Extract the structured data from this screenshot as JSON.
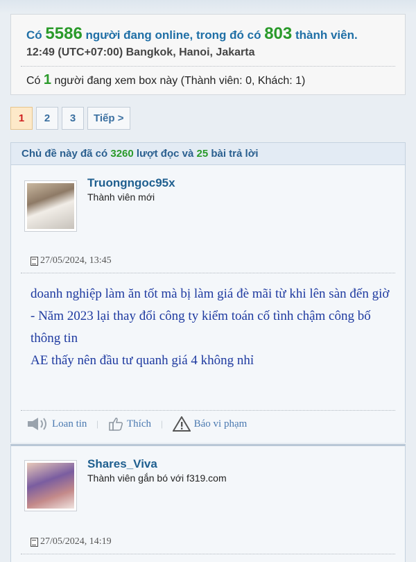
{
  "stats": {
    "online_prefix": "Có",
    "online_count": "5586",
    "online_mid": "người đang online, trong đó có",
    "member_count": "803",
    "online_suffix": "thành viên.",
    "time_line": "12:49 (UTC+07:00) Bangkok, Hanoi, Jakarta",
    "viewing_prefix": "Có",
    "viewing_count": "1",
    "viewing_suffix": "người đang xem box này (Thành viên: 0, Khách: 1)"
  },
  "pagination": {
    "pages": [
      "1",
      "2",
      "3"
    ],
    "current": "1",
    "next_label": "Tiếp >"
  },
  "thread": {
    "header_prefix": "Chủ đề này đã có",
    "views": "3260",
    "header_mid": "lượt đọc và",
    "replies": "25",
    "header_suffix": "bài trả lời"
  },
  "posts": [
    {
      "username": "Truongngoc95x",
      "user_title": "Thành viên mới",
      "date": "27/05/2024, 13:45",
      "message": [
        "doanh nghiệp làm ăn tốt mà bị làm giá đè mãi từ khi lên sàn đến giờ",
        "- Năm 2023 lại thay đổi công ty kiểm toán cố tình chậm công bố thông tin",
        "AE thấy nên đầu tư quanh giá 4 không nhỉ"
      ],
      "actions": {
        "report_spread": "Loan tin",
        "like": "Thích",
        "report_violation": "Báo vi phạm"
      }
    },
    {
      "username": "Shares_Viva",
      "user_title": "Thành viên gắn bó với f319.com",
      "date": "27/05/2024, 14:19"
    }
  ],
  "icons": {
    "date": "document-icon",
    "loan_tin": "speaker-icon",
    "thich": "thumbs-up-icon",
    "bao_vi_pham": "warning-icon"
  },
  "colors": {
    "link_blue": "#1f6fa6",
    "count_green": "#2a9a2a",
    "message_blue": "#1e3aa0",
    "active_page": "#d02020"
  }
}
